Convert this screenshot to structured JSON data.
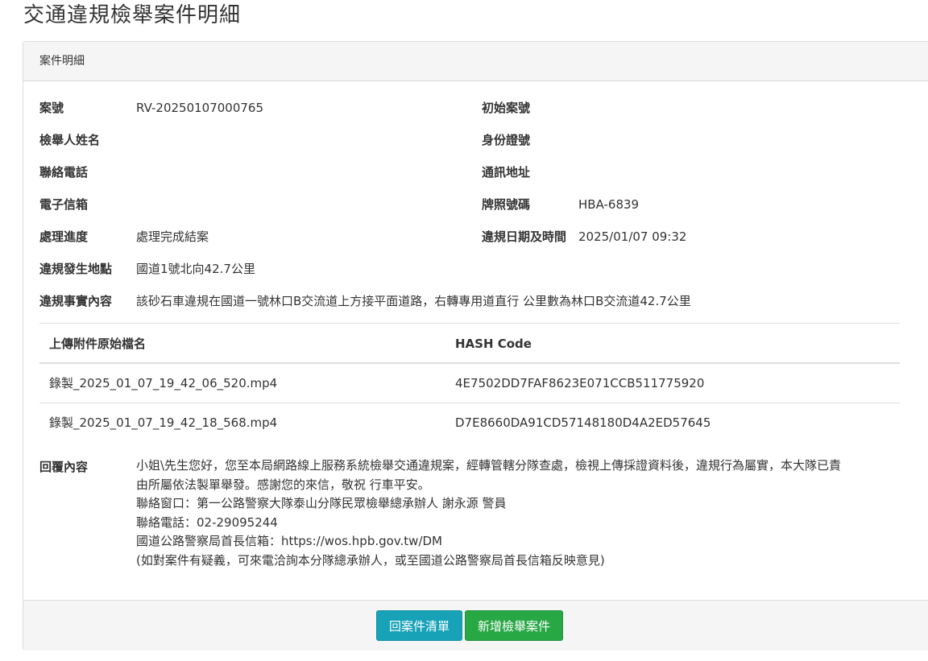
{
  "page": {
    "title": "交通違規檢舉案件明細"
  },
  "panel": {
    "heading": "案件明細"
  },
  "case": {
    "case_no_label": "案號",
    "case_no": "RV-20250107000765",
    "orig_case_no_label": "初始案號",
    "orig_case_no": "",
    "reporter_name_label": "檢舉人姓名",
    "reporter_name": "",
    "id_no_label": "身份證號",
    "id_no": "",
    "phone_label": "聯絡電話",
    "phone": "",
    "address_label": "通訊地址",
    "address": "",
    "email_label": "電子信箱",
    "email": "",
    "plate_label": "牌照號碼",
    "plate": "HBA-6839",
    "status_label": "處理進度",
    "status": "處理完成結案",
    "datetime_label": "違規日期及時間",
    "datetime": "2025/01/07 09:32",
    "location_label": "違規發生地點",
    "location": "國道1號北向42.7公里",
    "facts_label": "違規事實內容",
    "facts": "該砂石車違規在國道一號林口B交流道上方接平面道路，右轉專用道直行 公里數為林口B交流道42.7公里"
  },
  "attachments": {
    "header_filename": "上傳附件原始檔名",
    "header_hash": "HASH Code",
    "rows": [
      {
        "filename": "錄製_2025_01_07_19_42_06_520.mp4",
        "hash": "4E7502DD7FAF8623E071CCB511775920"
      },
      {
        "filename": "錄製_2025_01_07_19_42_18_568.mp4",
        "hash": "D7E8660DA91CD57148180D4A2ED57645"
      }
    ]
  },
  "reply": {
    "label": "回覆內容",
    "lines": [
      "小姐\\先生您好，您至本局網路線上服務系統檢舉交通違規案，經轉管轄分隊查處，檢視上傳採證資料後，違規行為屬實，本大隊已責",
      "由所屬依法製單舉發。感謝您的來信，敬祝 行車平安。",
      "聯絡窗口：第一公路警察大隊泰山分隊民眾檢舉總承辦人 謝永源 警員",
      "聯絡電話：02-29095244",
      "國道公路警察局首長信箱：https://wos.hpb.gov.tw/DM",
      "(如對案件有疑義，可來電洽詢本分隊總承辦人，或至國道公路警察局首長信箱反映意見)"
    ]
  },
  "footer": {
    "back_label": "回案件清單",
    "new_label": "新增檢舉案件"
  },
  "colors": {
    "info": "#17a2b8",
    "success": "#28a745",
    "heading_bg": "#f5f5f5",
    "border": "#dddddd"
  }
}
